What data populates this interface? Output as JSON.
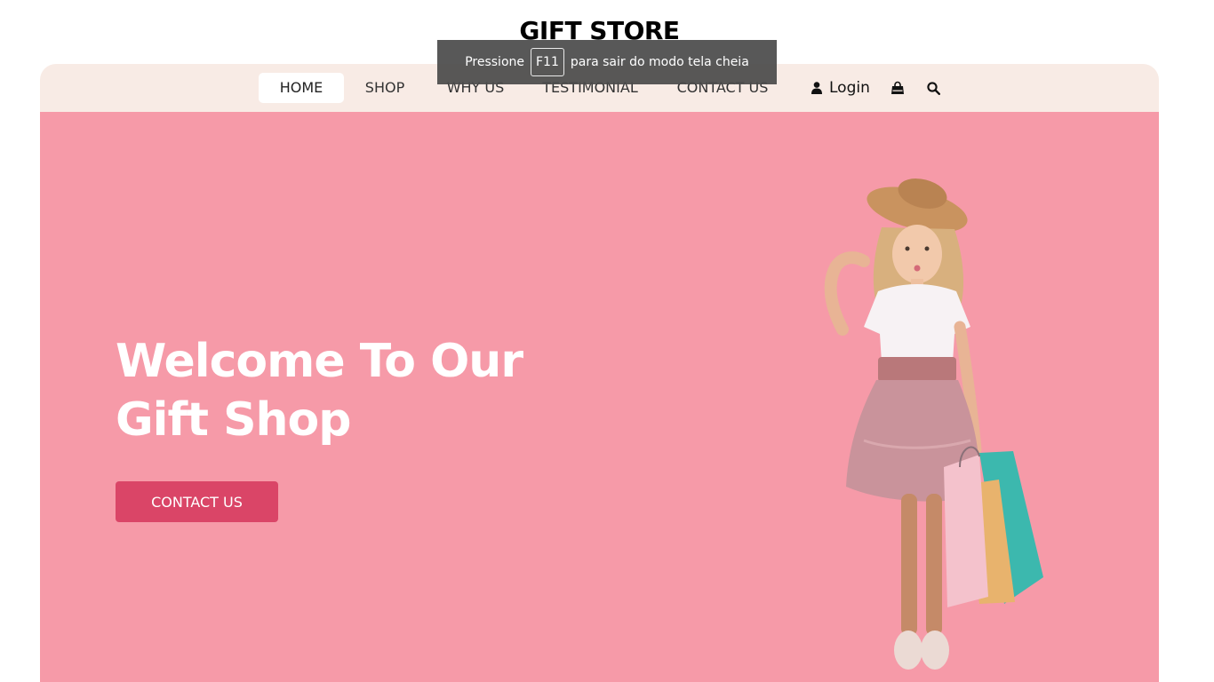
{
  "brand": {
    "title": "GIFT STORE"
  },
  "nav": {
    "items": [
      {
        "label": "HOME",
        "active": true
      },
      {
        "label": "SHOP",
        "active": false
      },
      {
        "label": "WHY US",
        "active": false
      },
      {
        "label": "TESTIMONIAL",
        "active": false
      },
      {
        "label": "CONTACT US",
        "active": false
      }
    ],
    "login_label": "Login",
    "user_icon": "user-icon",
    "bag_icon": "shopping-bag-icon",
    "search_icon": "search-icon"
  },
  "fullscreen_notice": {
    "before": "Pressione",
    "key": "F11",
    "after": "para sair do modo tela cheia"
  },
  "hero": {
    "title_line1": "Welcome To Our",
    "title_line2": "Gift Shop",
    "button_label": "CONTACT US",
    "image": "girl-with-shopping-bags"
  },
  "colors": {
    "hero_bg": "#f69aa8",
    "nav_bg": "#f8ebe5",
    "button_bg": "#da4567",
    "toast_bg": "#4b4b4b"
  }
}
